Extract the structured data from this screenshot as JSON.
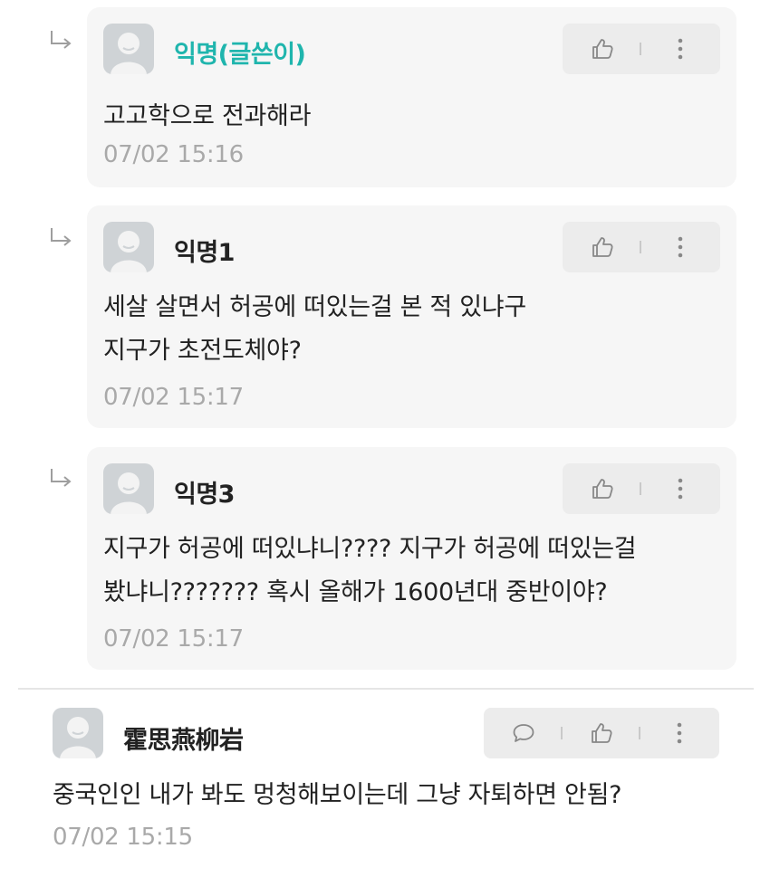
{
  "replies": [
    {
      "author": "익명(글쓴이)",
      "is_op": true,
      "lines": [
        "고고학으로 전과해라"
      ],
      "time": "07/02 15:16"
    },
    {
      "author": "익명1",
      "is_op": false,
      "lines": [
        "세살 살면서 허공에 떠있는걸 본 적 있냐구",
        "지구가 초전도체야?"
      ],
      "time": "07/02 15:17"
    },
    {
      "author": "익명3",
      "is_op": false,
      "lines": [
        "지구가 허공에 떠있냐니???? 지구가 허공에 떠있는걸",
        "봤냐니??????? 혹시 올해가 1600년대 중반이야?"
      ],
      "time": "07/02 15:17"
    }
  ],
  "comment": {
    "author": "霍思燕柳岩",
    "lines": [
      "중국인인 내가 봐도 멍청해보이는데 그냥 자퇴하면 안됨?"
    ],
    "time": "07/02 15:15"
  },
  "icons": {
    "reply_arrow": "reply-arrow-icon",
    "like": "thumbs-up-icon",
    "more": "more-vertical-icon",
    "comment": "speech-bubble-icon",
    "avatar": "default-avatar-icon"
  },
  "colors": {
    "op_author": "#1fb5ad",
    "card_bg": "#f6f6f6",
    "timestamp": "#a9a9a9"
  }
}
